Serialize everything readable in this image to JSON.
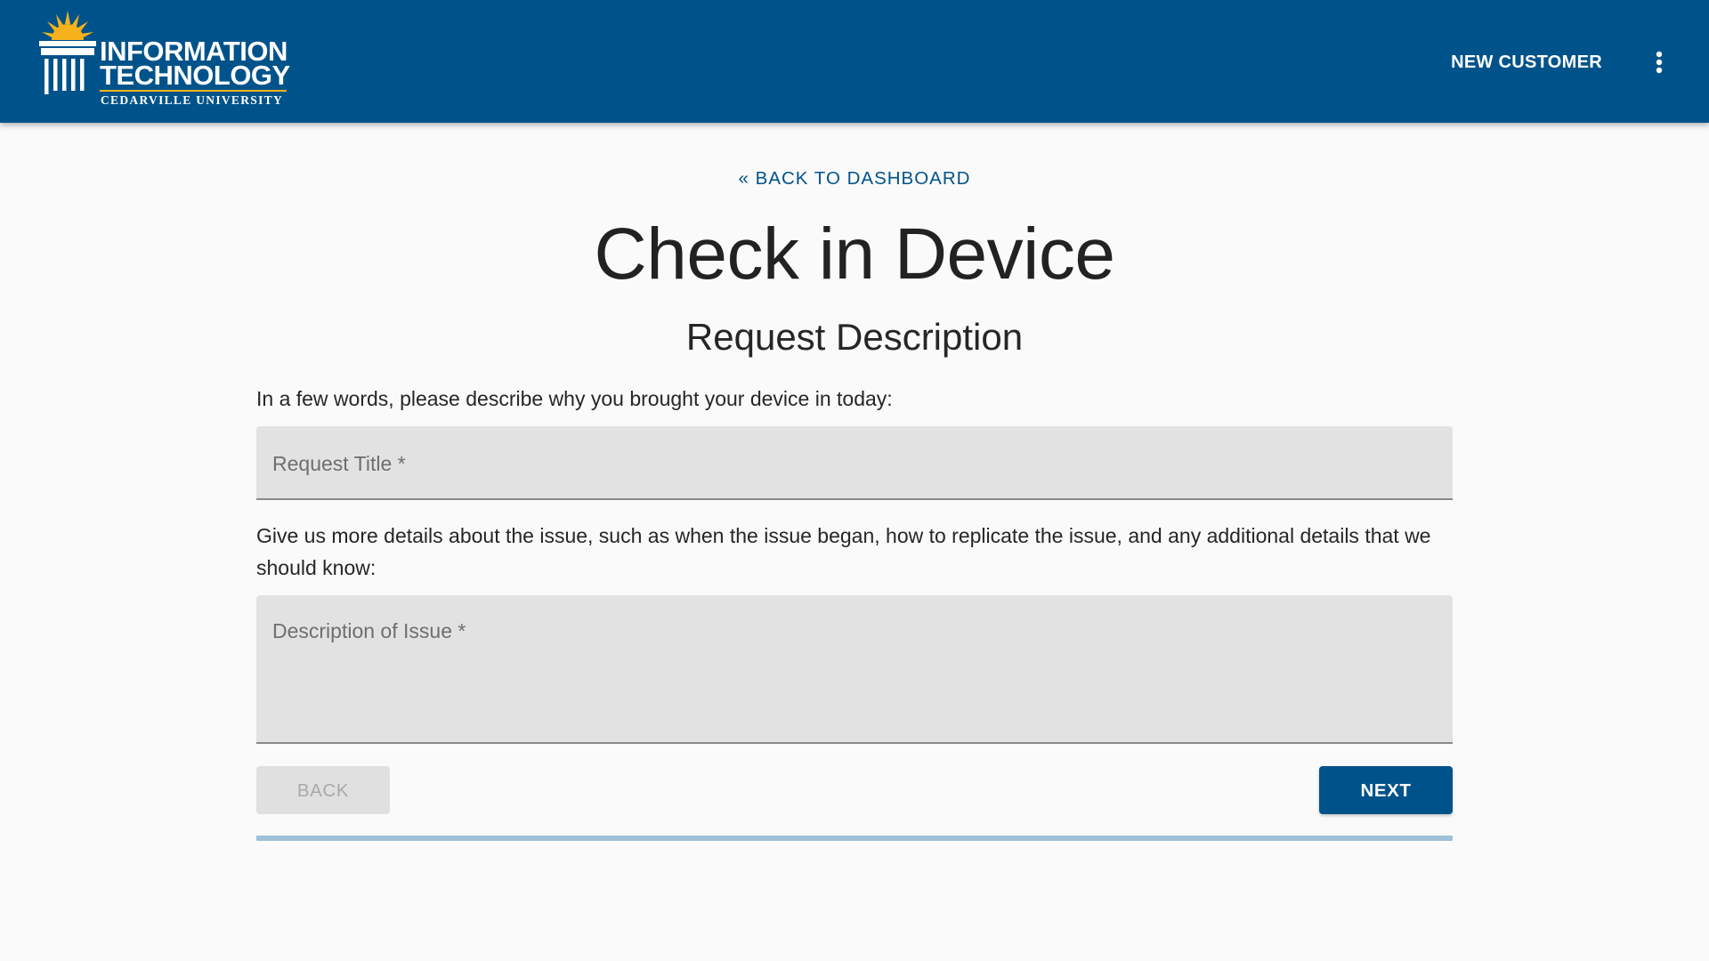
{
  "header": {
    "logo": {
      "line1": "INFORMATION",
      "line2": "TECHNOLOGY",
      "line3": "CEDARVILLE UNIVERSITY"
    },
    "new_customer_label": "NEW CUSTOMER",
    "menu_icon": "more-vert-icon"
  },
  "main": {
    "back_link_label": "« BACK TO DASHBOARD",
    "page_title": "Check in Device",
    "section_title": "Request Description",
    "title_prompt": "In a few words, please describe why you brought your device in today:",
    "title_field": {
      "placeholder": "Request Title *",
      "value": ""
    },
    "description_prompt": "Give us more details about the issue, such as when the issue began, how to replicate the issue, and any additional details that we should know:",
    "description_field": {
      "placeholder": "Description of Issue *",
      "value": ""
    },
    "back_button_label": "BACK",
    "next_button_label": "NEXT",
    "progress": 0
  },
  "colors": {
    "brand_blue": "#00538a",
    "accent_gold": "#f5b21a",
    "progress_track": "#9ec0d6"
  }
}
